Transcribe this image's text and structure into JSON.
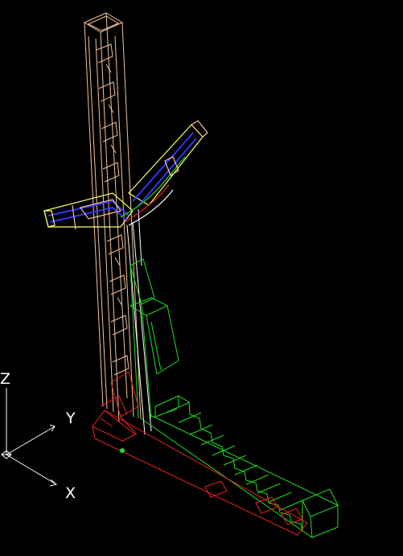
{
  "viewport": {
    "background": "#000000",
    "colors": {
      "tower": "#f5c49a",
      "tower_inner": "#ffffff",
      "base_green": "#22dd22",
      "base_red": "#ee2222",
      "arm_blue": "#3333ff",
      "arm_yellow": "#ffff66"
    }
  },
  "ucs": {
    "z_label": "Z",
    "y_label": "Y",
    "x_label": "X",
    "icon": "ucs-axis-icon"
  }
}
